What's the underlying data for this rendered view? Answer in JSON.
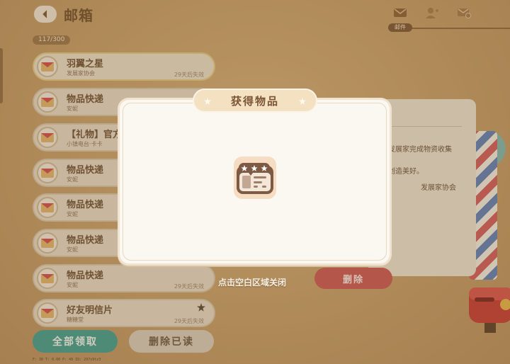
{
  "header": {
    "title": "邮箱",
    "counter": "117/300",
    "active_tab_label": "邮件",
    "tabs": [
      {
        "icon": "mail-icon"
      },
      {
        "icon": "friend-add-icon"
      },
      {
        "icon": "mail-settings-icon"
      }
    ]
  },
  "mails": [
    {
      "title": "羽翼之星",
      "sender": "发展家协会",
      "expire": "29天后失效",
      "active": true,
      "starred": false
    },
    {
      "title": "物品快递",
      "sender": "安妮",
      "expire": "",
      "active": false,
      "starred": false
    },
    {
      "title": "【礼物】官方",
      "sender": "小镇电台·卡卡",
      "expire": "",
      "active": false,
      "starred": false
    },
    {
      "title": "物品快递",
      "sender": "安妮",
      "expire": "",
      "active": false,
      "starred": false
    },
    {
      "title": "物品快递",
      "sender": "安妮",
      "expire": "",
      "active": false,
      "starred": false
    },
    {
      "title": "物品快递",
      "sender": "安妮",
      "expire": "",
      "active": false,
      "starred": false
    },
    {
      "title": "物品快递",
      "sender": "安妮",
      "expire": "29天后失效",
      "active": false,
      "starred": false
    },
    {
      "title": "好友明信片",
      "sender": "糖糖堂",
      "expire": "29天后失效",
      "active": false,
      "starred": true
    }
  ],
  "buttons": {
    "claim_all": "全部领取",
    "delete_read": "删除已读",
    "delete": "删除"
  },
  "detail": {
    "line1": "发展家完成物资收集",
    "line2": "创造美好。",
    "signature": "发展家协会"
  },
  "popup": {
    "title": "获得物品",
    "item_icon": "reward-ticket-icon",
    "tap_hint": "点击空白区域关闭"
  },
  "debug": "F: 30    T: 0.00    P: 49    ID: 297x9tz3"
}
